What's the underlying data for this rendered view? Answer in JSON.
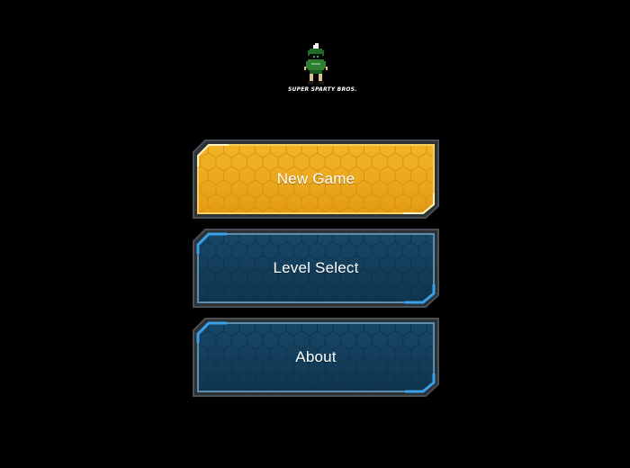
{
  "logo": {
    "text": "SUPER SPARTY BROS.",
    "icon": "pixel-spartan-character-icon"
  },
  "menu": {
    "items": [
      {
        "label": "New Game",
        "style": "gold"
      },
      {
        "label": "Level Select",
        "style": "blue"
      },
      {
        "label": "About",
        "style": "blue"
      }
    ]
  },
  "colors": {
    "background": "#000000",
    "gold_fill": "#e8a51c",
    "gold_border": "#f4c64a",
    "blue_fill": "#123b57",
    "blue_border": "#5a8fb0",
    "frame": "#2e3338",
    "label": "#ffffff"
  }
}
